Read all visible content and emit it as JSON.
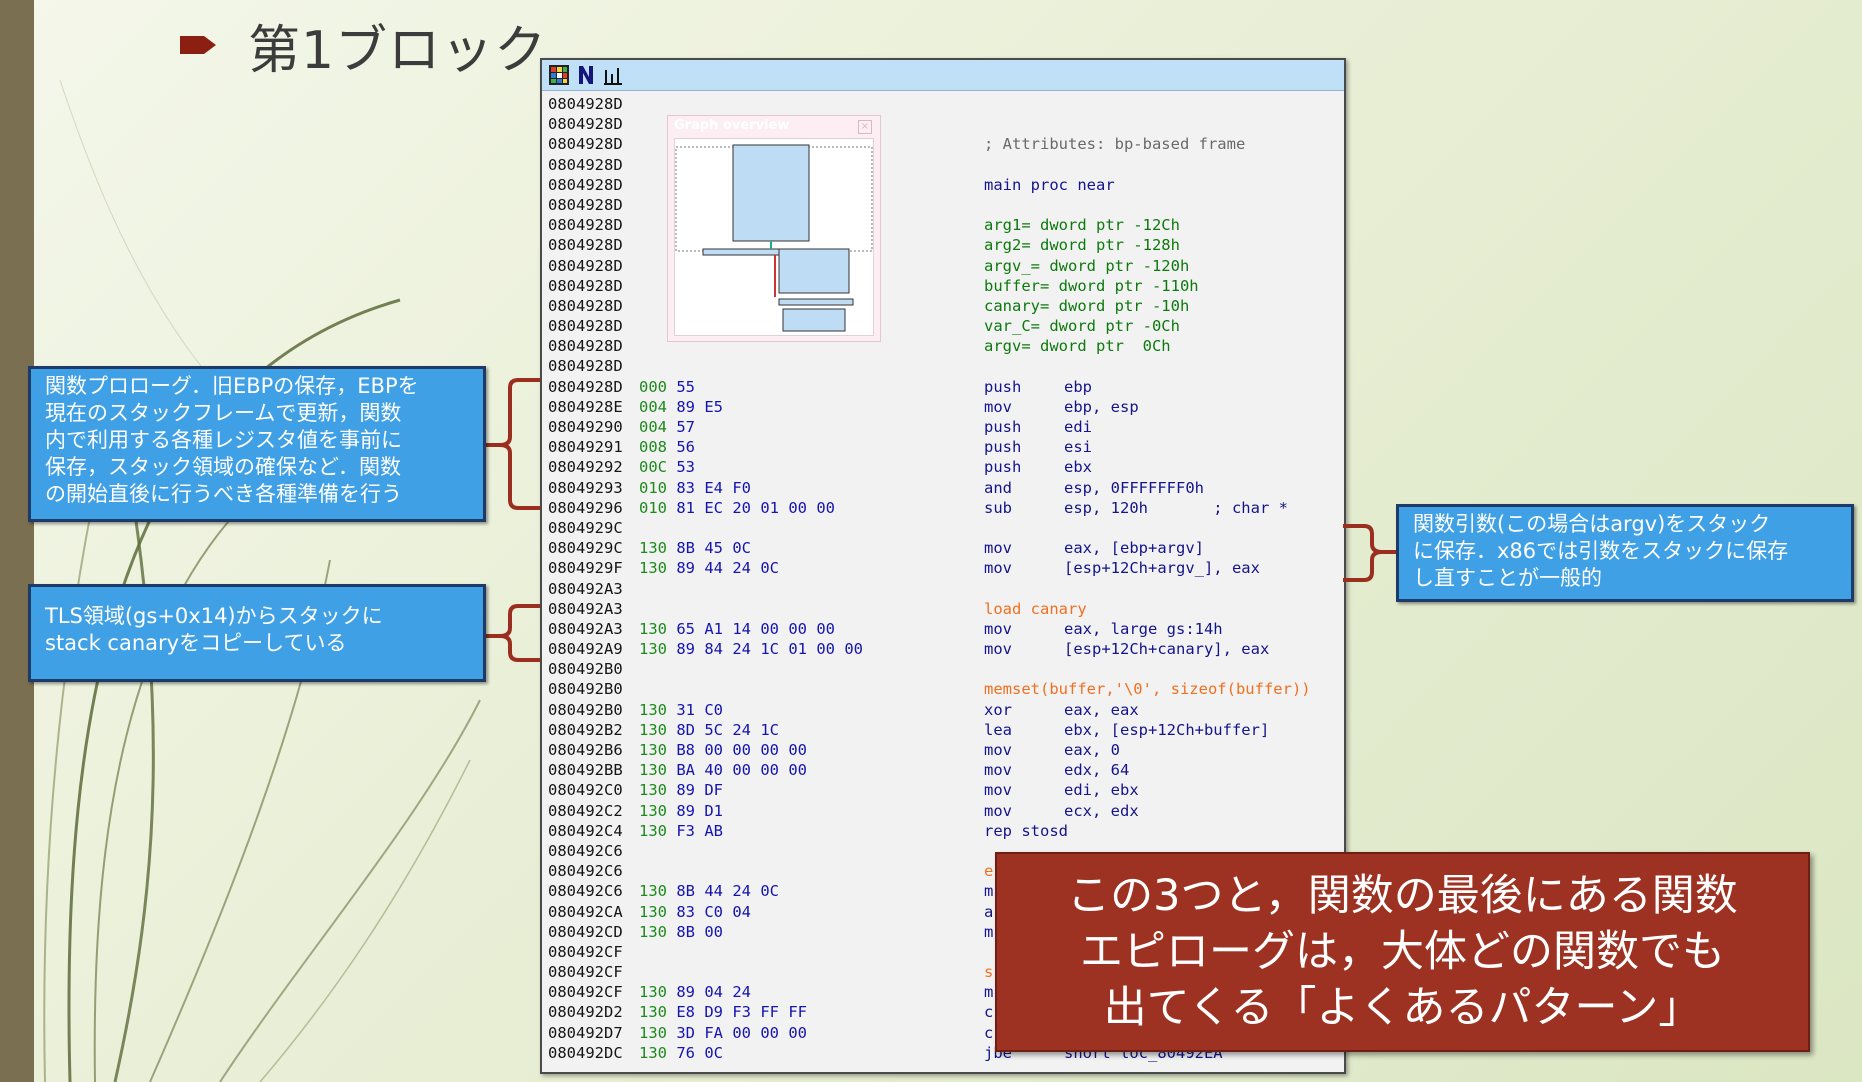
{
  "slide": {
    "title": "第1ブロック"
  },
  "ida": {
    "overview_title": "Graph overview",
    "overview_close": "×",
    "lines": [
      {
        "addr": "0804928D",
        "sp": "",
        "bytes": "",
        "text": "",
        "operands": "",
        "color": "c-blue"
      },
      {
        "addr": "0804928D",
        "sp": "",
        "bytes": "",
        "text": "",
        "operands": "",
        "color": "c-blue"
      },
      {
        "addr": "0804928D",
        "sp": "",
        "bytes": "",
        "text": "; Attributes: bp-based frame",
        "operands": "",
        "color": "c-gray"
      },
      {
        "addr": "0804928D",
        "sp": "",
        "bytes": "",
        "text": "",
        "operands": "",
        "color": "c-blue"
      },
      {
        "addr": "0804928D",
        "sp": "",
        "bytes": "",
        "text": "main proc near",
        "operands": "",
        "color": "c-blue"
      },
      {
        "addr": "0804928D",
        "sp": "",
        "bytes": "",
        "text": "",
        "operands": "",
        "color": "c-blue"
      },
      {
        "addr": "0804928D",
        "sp": "",
        "bytes": "",
        "text": "arg1= dword ptr -12Ch",
        "operands": "",
        "color": "c-green"
      },
      {
        "addr": "0804928D",
        "sp": "",
        "bytes": "",
        "text": "arg2= dword ptr -128h",
        "operands": "",
        "color": "c-green"
      },
      {
        "addr": "0804928D",
        "sp": "",
        "bytes": "",
        "text": "argv_= dword ptr -120h",
        "operands": "",
        "color": "c-green"
      },
      {
        "addr": "0804928D",
        "sp": "",
        "bytes": "",
        "text": "buffer= dword ptr -110h",
        "operands": "",
        "color": "c-green"
      },
      {
        "addr": "0804928D",
        "sp": "",
        "bytes": "",
        "text": "canary= dword ptr -10h",
        "operands": "",
        "color": "c-green"
      },
      {
        "addr": "0804928D",
        "sp": "",
        "bytes": "",
        "text": "var_C= dword ptr -0Ch",
        "operands": "",
        "color": "c-green"
      },
      {
        "addr": "0804928D",
        "sp": "",
        "bytes": "",
        "text": "argv= dword ptr  0Ch",
        "operands": "",
        "color": "c-green"
      },
      {
        "addr": "0804928D",
        "sp": "",
        "bytes": "",
        "text": "",
        "operands": "",
        "color": "c-blue"
      },
      {
        "addr": "0804928D",
        "sp": "000",
        "bytes": "55",
        "text": "push",
        "operands": "ebp",
        "color": "c-blue"
      },
      {
        "addr": "0804928E",
        "sp": "004",
        "bytes": "89 E5",
        "text": "mov",
        "operands": "ebp, esp",
        "color": "c-blue"
      },
      {
        "addr": "08049290",
        "sp": "004",
        "bytes": "57",
        "text": "push",
        "operands": "edi",
        "color": "c-blue"
      },
      {
        "addr": "08049291",
        "sp": "008",
        "bytes": "56",
        "text": "push",
        "operands": "esi",
        "color": "c-blue"
      },
      {
        "addr": "08049292",
        "sp": "00C",
        "bytes": "53",
        "text": "push",
        "operands": "ebx",
        "color": "c-blue"
      },
      {
        "addr": "08049293",
        "sp": "010",
        "bytes": "83 E4 F0",
        "text": "and",
        "operands": "esp, 0FFFFFFF0h",
        "color": "c-blue"
      },
      {
        "addr": "08049296",
        "sp": "010",
        "bytes": "81 EC 20 01 00 00",
        "text": "sub",
        "operands": "esp, 120h       ; char *",
        "color": "c-blue"
      },
      {
        "addr": "0804929C",
        "sp": "",
        "bytes": "",
        "text": "",
        "operands": "",
        "color": "c-blue"
      },
      {
        "addr": "0804929C",
        "sp": "130",
        "bytes": "8B 45 0C",
        "text": "mov",
        "operands": "eax, [ebp+argv]",
        "color": "c-blue"
      },
      {
        "addr": "0804929F",
        "sp": "130",
        "bytes": "89 44 24 0C",
        "text": "mov",
        "operands": "[esp+12Ch+argv_], eax",
        "color": "c-blue"
      },
      {
        "addr": "080492A3",
        "sp": "",
        "bytes": "",
        "text": "",
        "operands": "",
        "color": "c-blue"
      },
      {
        "addr": "080492A3",
        "sp": "",
        "bytes": "",
        "text": "load canary",
        "operands": "",
        "color": "c-orange"
      },
      {
        "addr": "080492A3",
        "sp": "130",
        "bytes": "65 A1 14 00 00 00",
        "text": "mov",
        "operands": "eax, large gs:14h",
        "color": "c-blue"
      },
      {
        "addr": "080492A9",
        "sp": "130",
        "bytes": "89 84 24 1C 01 00 00",
        "text": "mov",
        "operands": "[esp+12Ch+canary], eax",
        "color": "c-blue"
      },
      {
        "addr": "080492B0",
        "sp": "",
        "bytes": "",
        "text": "",
        "operands": "",
        "color": "c-blue"
      },
      {
        "addr": "080492B0",
        "sp": "",
        "bytes": "",
        "text": "memset(buffer,'\\0', sizeof(buffer))",
        "operands": "",
        "color": "c-orange"
      },
      {
        "addr": "080492B0",
        "sp": "130",
        "bytes": "31 C0",
        "text": "xor",
        "operands": "eax, eax",
        "color": "c-blue"
      },
      {
        "addr": "080492B2",
        "sp": "130",
        "bytes": "8D 5C 24 1C",
        "text": "lea",
        "operands": "ebx, [esp+12Ch+buffer]",
        "color": "c-blue"
      },
      {
        "addr": "080492B6",
        "sp": "130",
        "bytes": "B8 00 00 00 00",
        "text": "mov",
        "operands": "eax, 0",
        "color": "c-blue"
      },
      {
        "addr": "080492BB",
        "sp": "130",
        "bytes": "BA 40 00 00 00",
        "text": "mov",
        "operands": "edx, 64",
        "color": "c-blue"
      },
      {
        "addr": "080492C0",
        "sp": "130",
        "bytes": "89 DF",
        "text": "mov",
        "operands": "edi, ebx",
        "color": "c-blue"
      },
      {
        "addr": "080492C2",
        "sp": "130",
        "bytes": "89 D1",
        "text": "mov",
        "operands": "ecx, edx",
        "color": "c-blue"
      },
      {
        "addr": "080492C4",
        "sp": "130",
        "bytes": "F3 AB",
        "text": "rep stosd",
        "operands": "",
        "color": "c-blue"
      },
      {
        "addr": "080492C6",
        "sp": "",
        "bytes": "",
        "text": "",
        "operands": "",
        "color": "c-blue"
      },
      {
        "addr": "080492C6",
        "sp": "",
        "bytes": "",
        "text": "e",
        "operands": "",
        "color": "c-orange"
      },
      {
        "addr": "080492C6",
        "sp": "130",
        "bytes": "8B 44 24 0C",
        "text": "m",
        "operands": "",
        "color": "c-blue"
      },
      {
        "addr": "080492CA",
        "sp": "130",
        "bytes": "83 C0 04",
        "text": "a",
        "operands": "",
        "color": "c-blue"
      },
      {
        "addr": "080492CD",
        "sp": "130",
        "bytes": "8B 00",
        "text": "m",
        "operands": "",
        "color": "c-blue"
      },
      {
        "addr": "080492CF",
        "sp": "",
        "bytes": "",
        "text": "",
        "operands": "",
        "color": "c-blue"
      },
      {
        "addr": "080492CF",
        "sp": "",
        "bytes": "",
        "text": "s",
        "operands": "",
        "color": "c-orange"
      },
      {
        "addr": "080492CF",
        "sp": "130",
        "bytes": "89 04 24",
        "text": "m",
        "operands": "",
        "color": "c-blue"
      },
      {
        "addr": "080492D2",
        "sp": "130",
        "bytes": "E8 D9 F3 FF FF",
        "text": "c",
        "operands": "",
        "color": "c-blue"
      },
      {
        "addr": "080492D7",
        "sp": "130",
        "bytes": "3D FA 00 00 00",
        "text": "c",
        "operands": "",
        "color": "c-blue"
      },
      {
        "addr": "080492DC",
        "sp": "130",
        "bytes": "76 0C",
        "text": "jbe",
        "operands": "short loc_80492EA",
        "color": "c-blue"
      }
    ]
  },
  "callouts": {
    "prologue": [
      "関数プロローグ．旧EBPの保存，EBPを",
      "現在のスタックフレームで更新，関数",
      "内で利用する各種レジスタ値を事前に",
      "保存，スタック領域の確保など．関数",
      "の開始直後に行うべき各種準備を行う"
    ],
    "tls": [
      "TLS領域(gs+0x14)からスタックに",
      "stack canaryをコピーしている"
    ],
    "args": [
      "関数引数(この場合はargv)をスタック",
      "に保存．x86では引数をスタックに保存",
      "し直すことが一般的"
    ],
    "summary": [
      "この3つと，関数の最後にある関数",
      "エピローグは，大体どの関数でも",
      "出てくる「よくあるパターン」"
    ]
  },
  "colors": {
    "callout_blue": "#3fa0e6",
    "summary_red": "#9e3222",
    "bracket": "#9a2f1f",
    "toolbar": "#bfe0f7"
  }
}
